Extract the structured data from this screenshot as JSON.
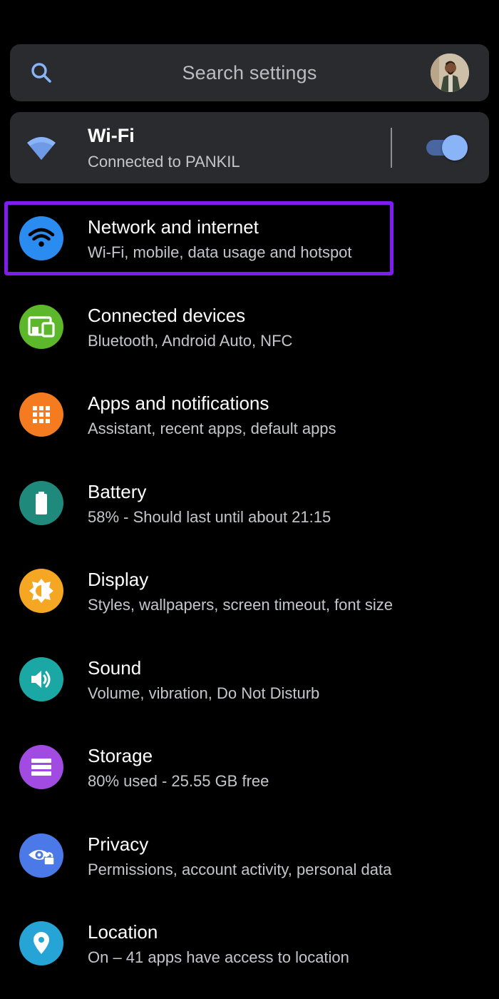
{
  "search": {
    "placeholder": "Search settings"
  },
  "wifi_card": {
    "title": "Wi-Fi",
    "subtitle": "Connected to PANKIL",
    "toggle_on": true
  },
  "colors": {
    "background": "#000000",
    "card": "#2a2b2e",
    "highlight": "#7f1cf0",
    "toggle_thumb": "#8ab4f8"
  },
  "items": [
    {
      "title": "Network and internet",
      "subtitle": "Wi-Fi, mobile, data usage and hotspot",
      "icon": "wifi-icon",
      "color": "#2a8cf0"
    },
    {
      "title": "Connected devices",
      "subtitle": "Bluetooth, Android Auto, NFC",
      "icon": "devices-icon",
      "color": "#5cb82a"
    },
    {
      "title": "Apps and notifications",
      "subtitle": "Assistant, recent apps, default apps",
      "icon": "apps-grid-icon",
      "color": "#f47b1f"
    },
    {
      "title": "Battery",
      "subtitle": "58% - Should last until about 21:15",
      "icon": "battery-icon",
      "color": "#1f8a7b"
    },
    {
      "title": "Display",
      "subtitle": "Styles, wallpapers, screen timeout, font size",
      "icon": "brightness-icon",
      "color": "#f5a623"
    },
    {
      "title": "Sound",
      "subtitle": "Volume, vibration, Do Not Disturb",
      "icon": "volume-icon",
      "color": "#1ba8a5"
    },
    {
      "title": "Storage",
      "subtitle": "80% used - 25.55 GB free",
      "icon": "storage-icon",
      "color": "#a24be3"
    },
    {
      "title": "Privacy",
      "subtitle": "Permissions, account activity, personal data",
      "icon": "privacy-icon",
      "color": "#4b79e8"
    },
    {
      "title": "Location",
      "subtitle": "On – 41 apps have access to location",
      "icon": "location-pin-icon",
      "color": "#27a4d6"
    }
  ]
}
